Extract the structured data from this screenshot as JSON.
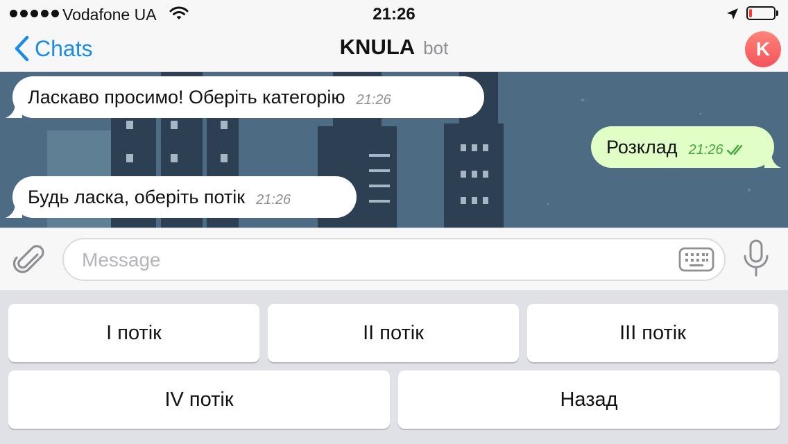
{
  "status_bar": {
    "carrier": "Vodafone UA",
    "time": "21:26",
    "signal_icon": "signal-dots-icon",
    "wifi_icon": "wifi-icon",
    "location_icon": "location-arrow-icon",
    "battery_icon": "battery-icon",
    "battery_level": 0.12,
    "battery_color": "#ff3b30"
  },
  "nav": {
    "back_label": "Chats",
    "title": "KNULA",
    "subtitle": "bot",
    "avatar_letter": "K",
    "accent_color": "#1a8ce8"
  },
  "messages": [
    {
      "direction": "incoming",
      "text": "Ласкаво просимо! Оберіть категорію",
      "time": "21:26"
    },
    {
      "direction": "outgoing",
      "text": "Розклад",
      "time": "21:26",
      "read_icon": "double-check-icon"
    },
    {
      "direction": "incoming",
      "text": "Будь ласка, оберіть потік",
      "time": "21:26"
    }
  ],
  "input": {
    "placeholder": "Message",
    "attach_icon": "paperclip-icon",
    "keyboard_icon": "keyboard-icon",
    "mic_icon": "microphone-icon"
  },
  "keyboard": {
    "rows": [
      [
        "I потік",
        "II потік",
        "III потік"
      ],
      [
        "IV потік",
        "Назад"
      ]
    ]
  }
}
